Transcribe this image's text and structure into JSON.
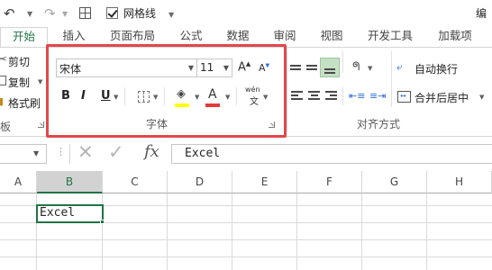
{
  "qat": {
    "gridlines_label": "网格线",
    "gridlines_checked": true,
    "title_fragment": "编"
  },
  "tabs": [
    {
      "label": "开始",
      "active": true
    },
    {
      "label": "插入",
      "active": false
    },
    {
      "label": "页面布局",
      "active": false
    },
    {
      "label": "公式",
      "active": false
    },
    {
      "label": "数据",
      "active": false
    },
    {
      "label": "审阅",
      "active": false
    },
    {
      "label": "视图",
      "active": false
    },
    {
      "label": "开发工具",
      "active": false
    },
    {
      "label": "加载项",
      "active": false
    }
  ],
  "clipboard": {
    "cut_label": "剪切",
    "copy_label": "复制",
    "format_painter_label": "格式刷",
    "group_label_fragment": "板"
  },
  "font_group": {
    "font_name": "宋体",
    "font_size": "11",
    "bold_label": "B",
    "italic_label": "I",
    "underline_label": "U",
    "font_color_label": "A",
    "phonetic_label": "wén",
    "phonetic_sub": "文",
    "group_label": "字体"
  },
  "alignment": {
    "wrap_text_label": "自动换行",
    "merge_center_label": "合并后居中",
    "group_label": "对齐方式"
  },
  "formula_bar": {
    "fx_label": "fx",
    "content": "Excel"
  },
  "grid": {
    "columns": [
      "A",
      "B",
      "C",
      "D",
      "E",
      "F",
      "G",
      "H"
    ],
    "selected_column": "B",
    "active_cell_value": "Excel"
  },
  "colors": {
    "accent": "#217346",
    "highlight": "#e2474c",
    "fill_yellow": "#ffff00",
    "font_red": "#e23a3a"
  }
}
